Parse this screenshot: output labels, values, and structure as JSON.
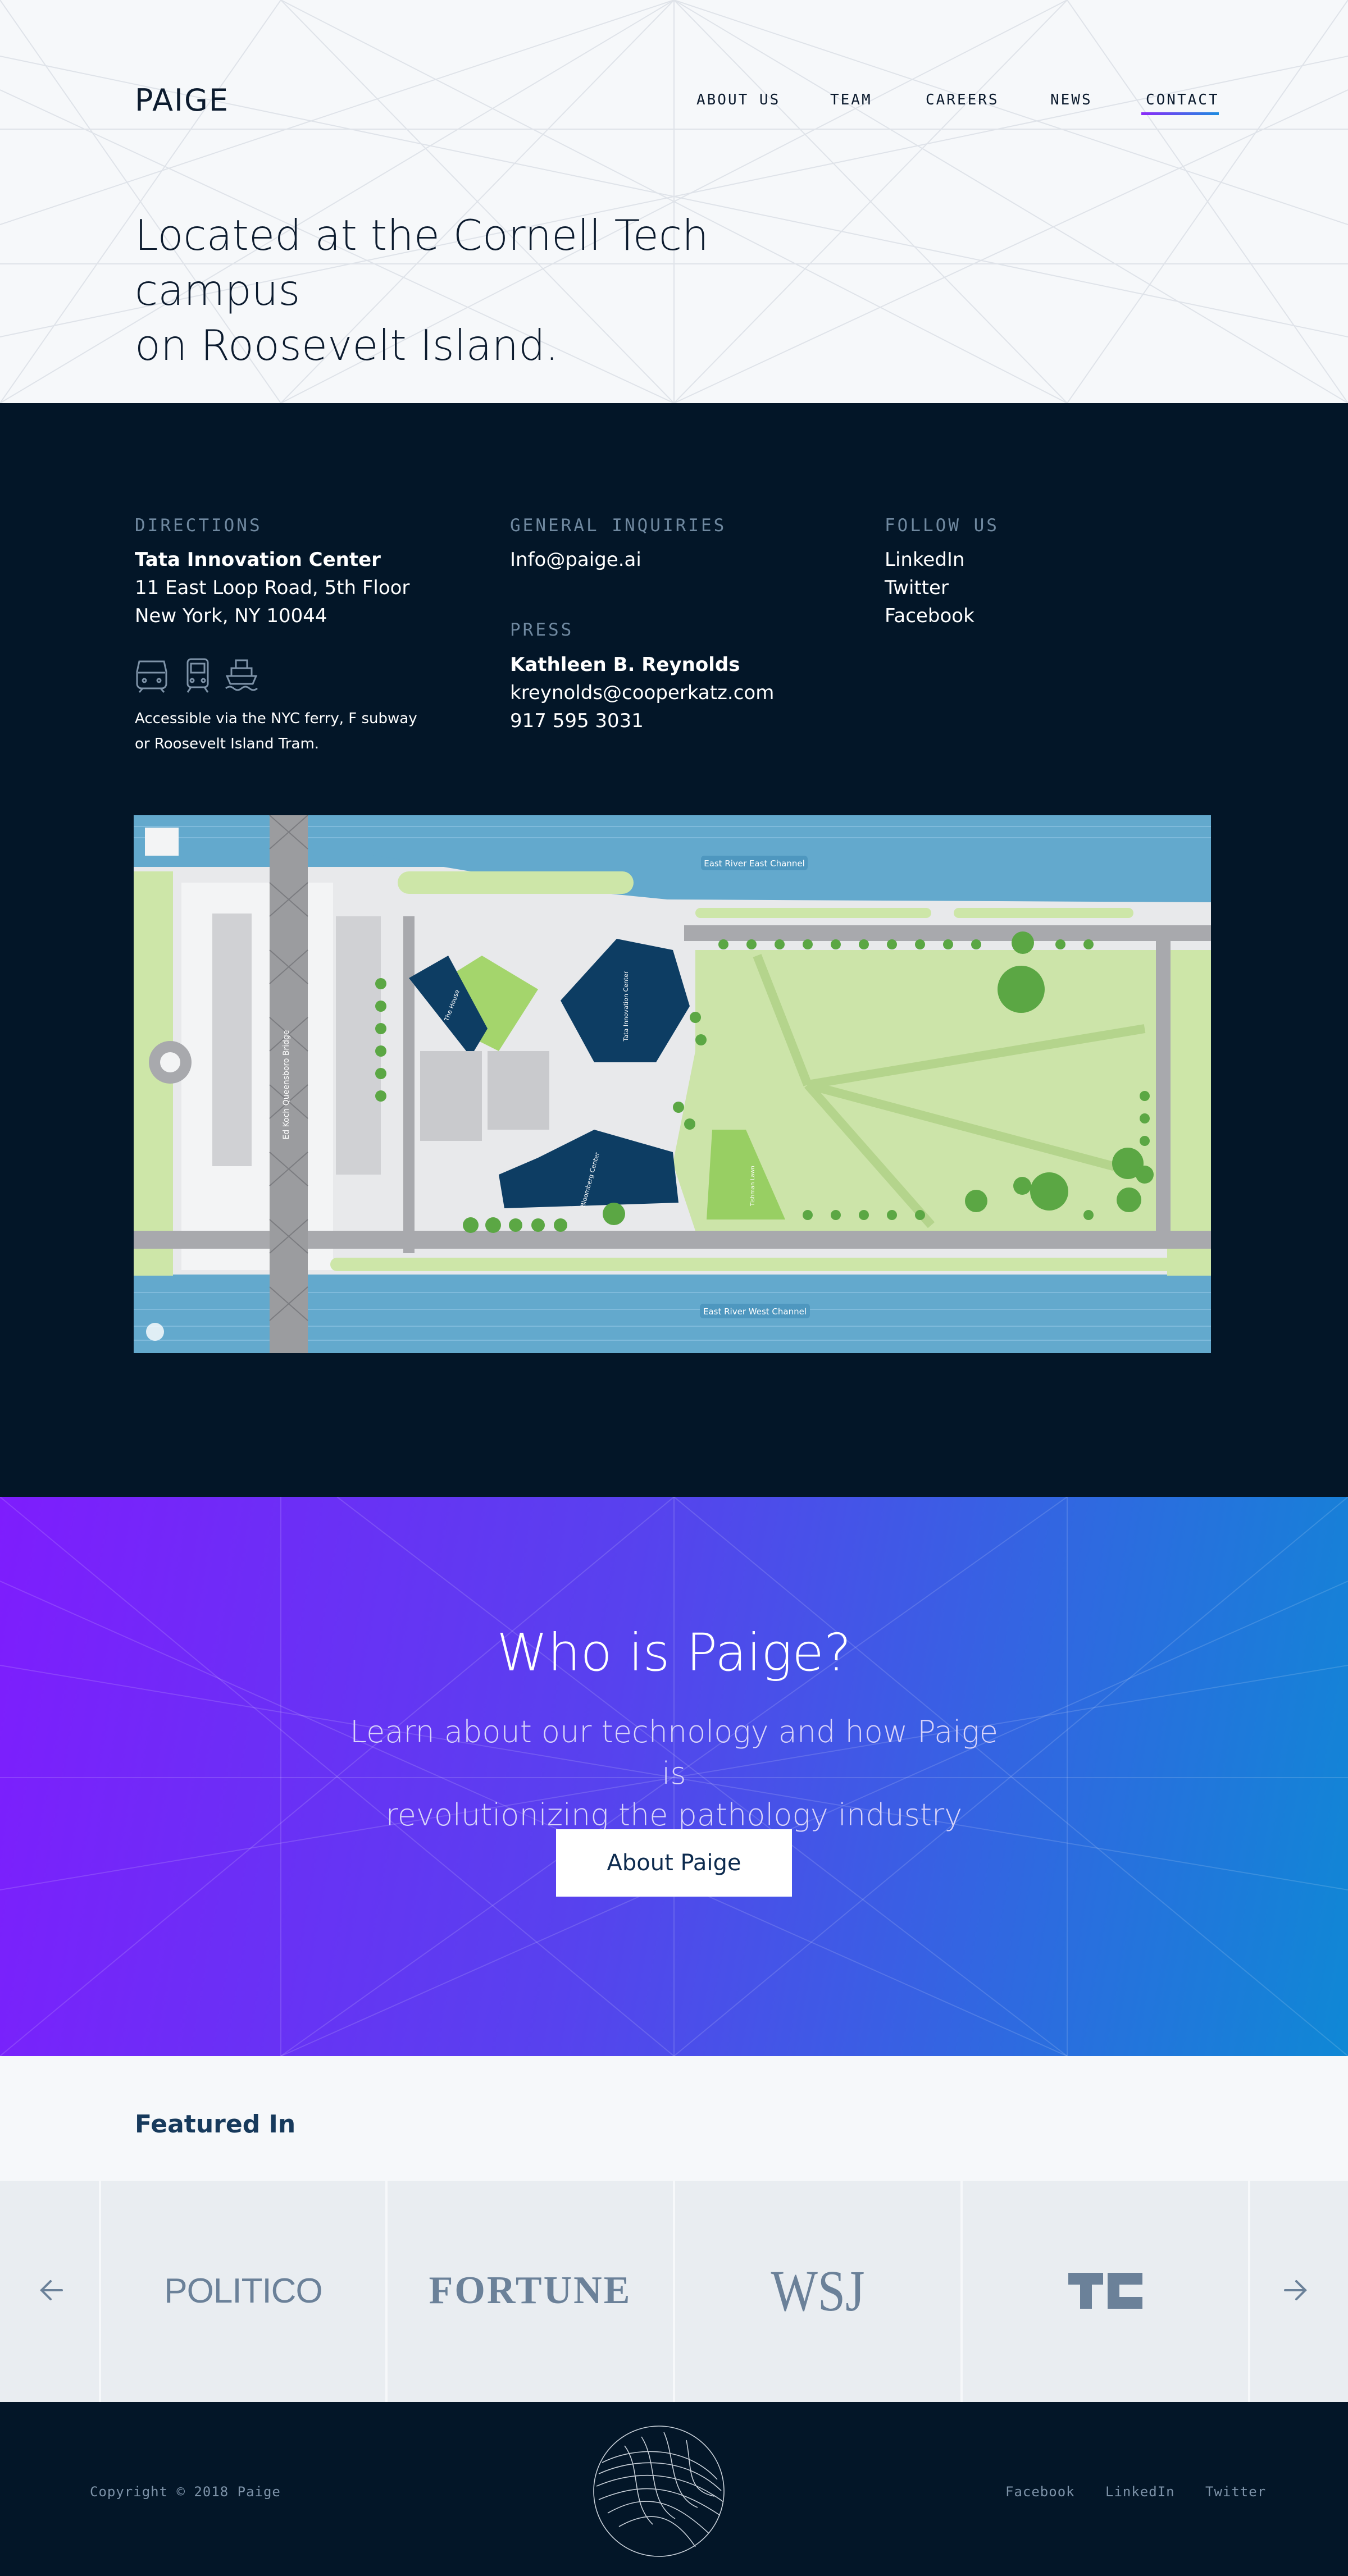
{
  "header": {
    "logo": "PAIGE",
    "nav": [
      "ABOUT US",
      "TEAM",
      "CAREERS",
      "NEWS",
      "CONTACT"
    ],
    "active_nav": "CONTACT"
  },
  "hero": {
    "title_line1": "Located at the Cornell Tech campus",
    "title_line2": "on Roosevelt Island."
  },
  "directions": {
    "label": "DIRECTIONS",
    "name": "Tata Innovation Center",
    "address1": "11 East Loop Road, 5th Floor",
    "address2": "New York, NY 10044",
    "transit_icons": [
      "subway-icon",
      "train-icon",
      "ferry-icon"
    ],
    "note_line1": "Accessible via the NYC ferry, F subway",
    "note_line2": "or Roosevelt Island Tram."
  },
  "inquiries": {
    "label": "GENERAL INQUIRIES",
    "email": "Info@paige.ai"
  },
  "press": {
    "label": "PRESS",
    "name": "Kathleen B. Reynolds",
    "email": "kreynolds@cooperkatz.com",
    "phone": "917 595 3031"
  },
  "follow": {
    "label": "FOLLOW US",
    "links": [
      "LinkedIn",
      "Twitter",
      "Facebook"
    ]
  },
  "map": {
    "north_channel": "East River East Channel",
    "south_channel": "East River West Channel",
    "bridge": "Ed Koch Queensboro Bridge",
    "building_tata": "Tata Innovation Center",
    "building_house": "The House",
    "building_bloomberg": "Bloomberg Center",
    "lawn": "Tishman Lawn"
  },
  "who": {
    "title": "Who is Paige?",
    "subtitle_line1": "Learn about our technology and how Paige is",
    "subtitle_line2": "revolutionizing the pathology industry",
    "button": "About Paige"
  },
  "featured": {
    "title": "Featured In",
    "logos": [
      "POLITICO",
      "FORTUNE",
      "WSJ",
      "TC"
    ]
  },
  "footer": {
    "copyright": "Copyright © 2018 Paige",
    "links": [
      "Facebook",
      "LinkedIn",
      "Twitter"
    ]
  },
  "colors": {
    "navy": "#031628",
    "hero_bg": "#f6f8fa",
    "gradient_start": "#7e1dfd",
    "gradient_end": "#0f88d5",
    "water": "#63a9cd",
    "park": "#cce4a9",
    "tree": "#5ba744",
    "building": "#0d3d63"
  }
}
